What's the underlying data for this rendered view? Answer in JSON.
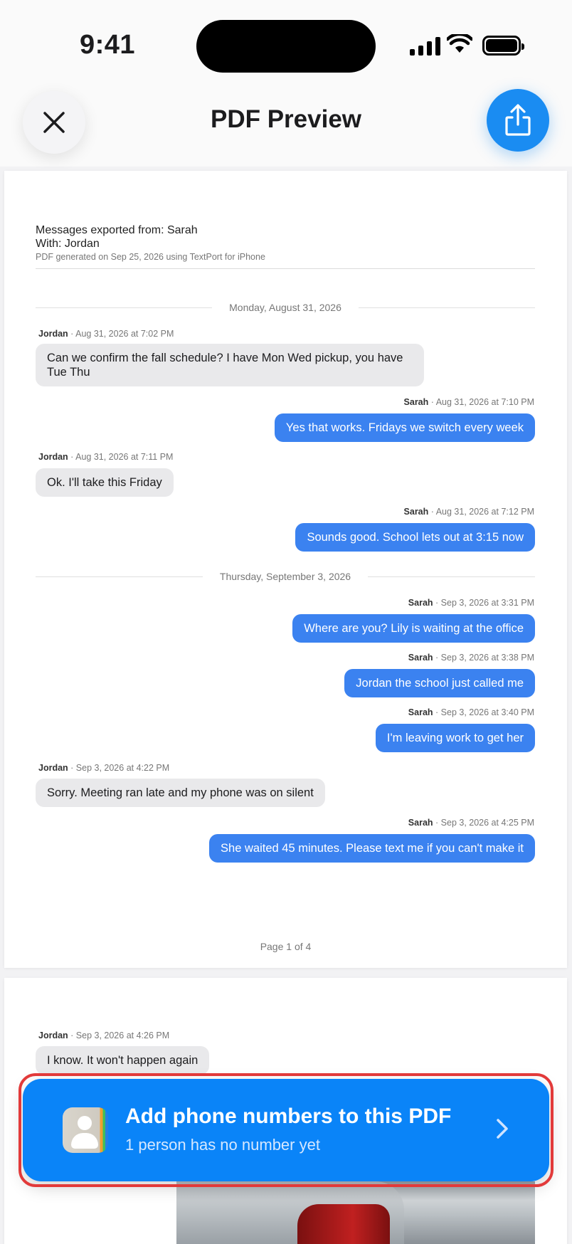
{
  "status": {
    "time": "9:41"
  },
  "nav": {
    "title": "PDF Preview",
    "close_icon": "close-icon",
    "share_icon": "share-icon"
  },
  "pdf": {
    "header": {
      "line1": "Messages exported from: Sarah",
      "line2": "With: Jordan",
      "line3": "PDF generated on Sep 25, 2026 using TextPort for iPhone"
    },
    "dates": [
      "Monday, August 31, 2026",
      "Thursday, September 3, 2026"
    ],
    "messages": [
      {
        "sender": "Jordan",
        "stamp": " · Aug 31, 2026 at 7:02 PM",
        "text": "Can we confirm the fall schedule? I have Mon Wed pickup, you have Tue Thu"
      },
      {
        "sender": "Sarah",
        "stamp": " · Aug 31, 2026 at 7:10 PM",
        "text": "Yes that works. Fridays we switch every week"
      },
      {
        "sender": "Jordan",
        "stamp": " · Aug 31, 2026 at 7:11 PM",
        "text": "Ok. I'll take this Friday"
      },
      {
        "sender": "Sarah",
        "stamp": " · Aug 31, 2026 at 7:12 PM",
        "text": "Sounds good. School lets out at 3:15 now"
      },
      {
        "sender": "Sarah",
        "stamp": " · Sep 3, 2026 at 3:31 PM",
        "text": "Where are you? Lily is waiting at the office"
      },
      {
        "sender": "Sarah",
        "stamp": " · Sep 3, 2026 at 3:38 PM",
        "text": "Jordan the school just called me"
      },
      {
        "sender": "Sarah",
        "stamp": " · Sep 3, 2026 at 3:40 PM",
        "text": "I'm leaving work to get her"
      },
      {
        "sender": "Jordan",
        "stamp": " · Sep 3, 2026 at 4:22 PM",
        "text": "Sorry. Meeting ran late and my phone was on silent"
      },
      {
        "sender": "Sarah",
        "stamp": " · Sep 3, 2026 at 4:25 PM",
        "text": "She waited 45 minutes. Please text me if you can't make it"
      },
      {
        "sender": "Jordan",
        "stamp": " · Sep 3, 2026 at 4:26 PM",
        "text": "I know. It won't happen again"
      }
    ],
    "footer": "Page 1 of 4"
  },
  "banner": {
    "title": "Add phone numbers to this PDF",
    "subtitle": "1 person has no number yet",
    "icon": "contacts-icon",
    "chevron": "chevron-right-icon"
  }
}
